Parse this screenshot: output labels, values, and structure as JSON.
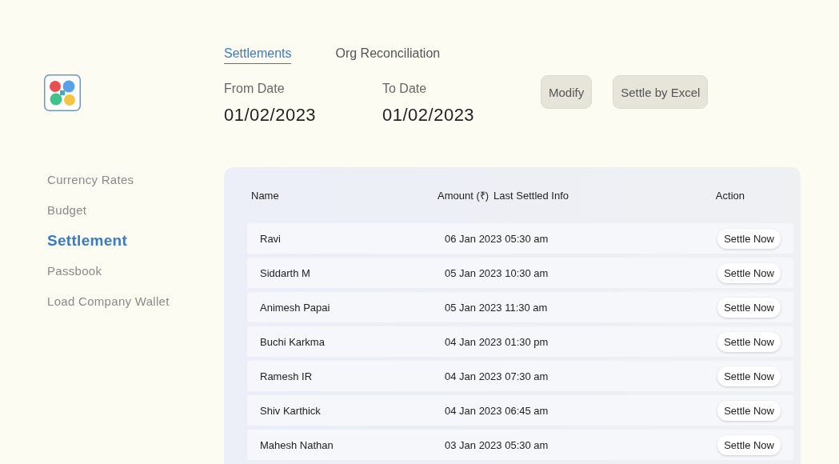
{
  "tabs": [
    {
      "label": "Settlements",
      "selected": true
    },
    {
      "label": "Org Reconciliation",
      "selected": false
    }
  ],
  "sidebar": {
    "items": [
      {
        "label": "Currency Rates",
        "selected": false
      },
      {
        "label": "Budget",
        "selected": false
      },
      {
        "label": "Settlement",
        "selected": true
      },
      {
        "label": "Passbook",
        "selected": false
      },
      {
        "label": "Load Company Wallet",
        "selected": false
      }
    ]
  },
  "filters": [
    {
      "label": "From Date",
      "value": "01/02/2023"
    },
    {
      "label": "To Date",
      "value": "01/02/2023"
    }
  ],
  "buttons": [
    "Modify",
    "Settle by Excel"
  ],
  "table": {
    "columns": [
      "Name",
      "Amount (₹)",
      "Last Settled Info",
      "Action"
    ],
    "rows": [
      {
        "name": "Ravi",
        "last_settled": "06 Jan 2023 05:30 am",
        "action": "Settle Now"
      },
      {
        "name": "Siddarth M",
        "last_settled": "05 Jan 2023 10:30 am",
        "action": "Settle Now"
      },
      {
        "name": "Animesh Papai",
        "last_settled": "05 Jan 2023 11:30 am",
        "action": "Settle Now"
      },
      {
        "name": "Buchi Karkma",
        "last_settled": "04 Jan 2023 01:30 pm",
        "action": "Settle Now"
      },
      {
        "name": "Ramesh IR",
        "last_settled": "04 Jan 2023 07:30 am",
        "action": "Settle Now"
      },
      {
        "name": "Shiv Karthick",
        "last_settled": "04 Jan 2023 06:45 am",
        "action": "Settle Now"
      },
      {
        "name": "Mahesh Nathan",
        "last_settled": "03 Jan 2023 05:30 am",
        "action": "Settle Now"
      }
    ]
  }
}
